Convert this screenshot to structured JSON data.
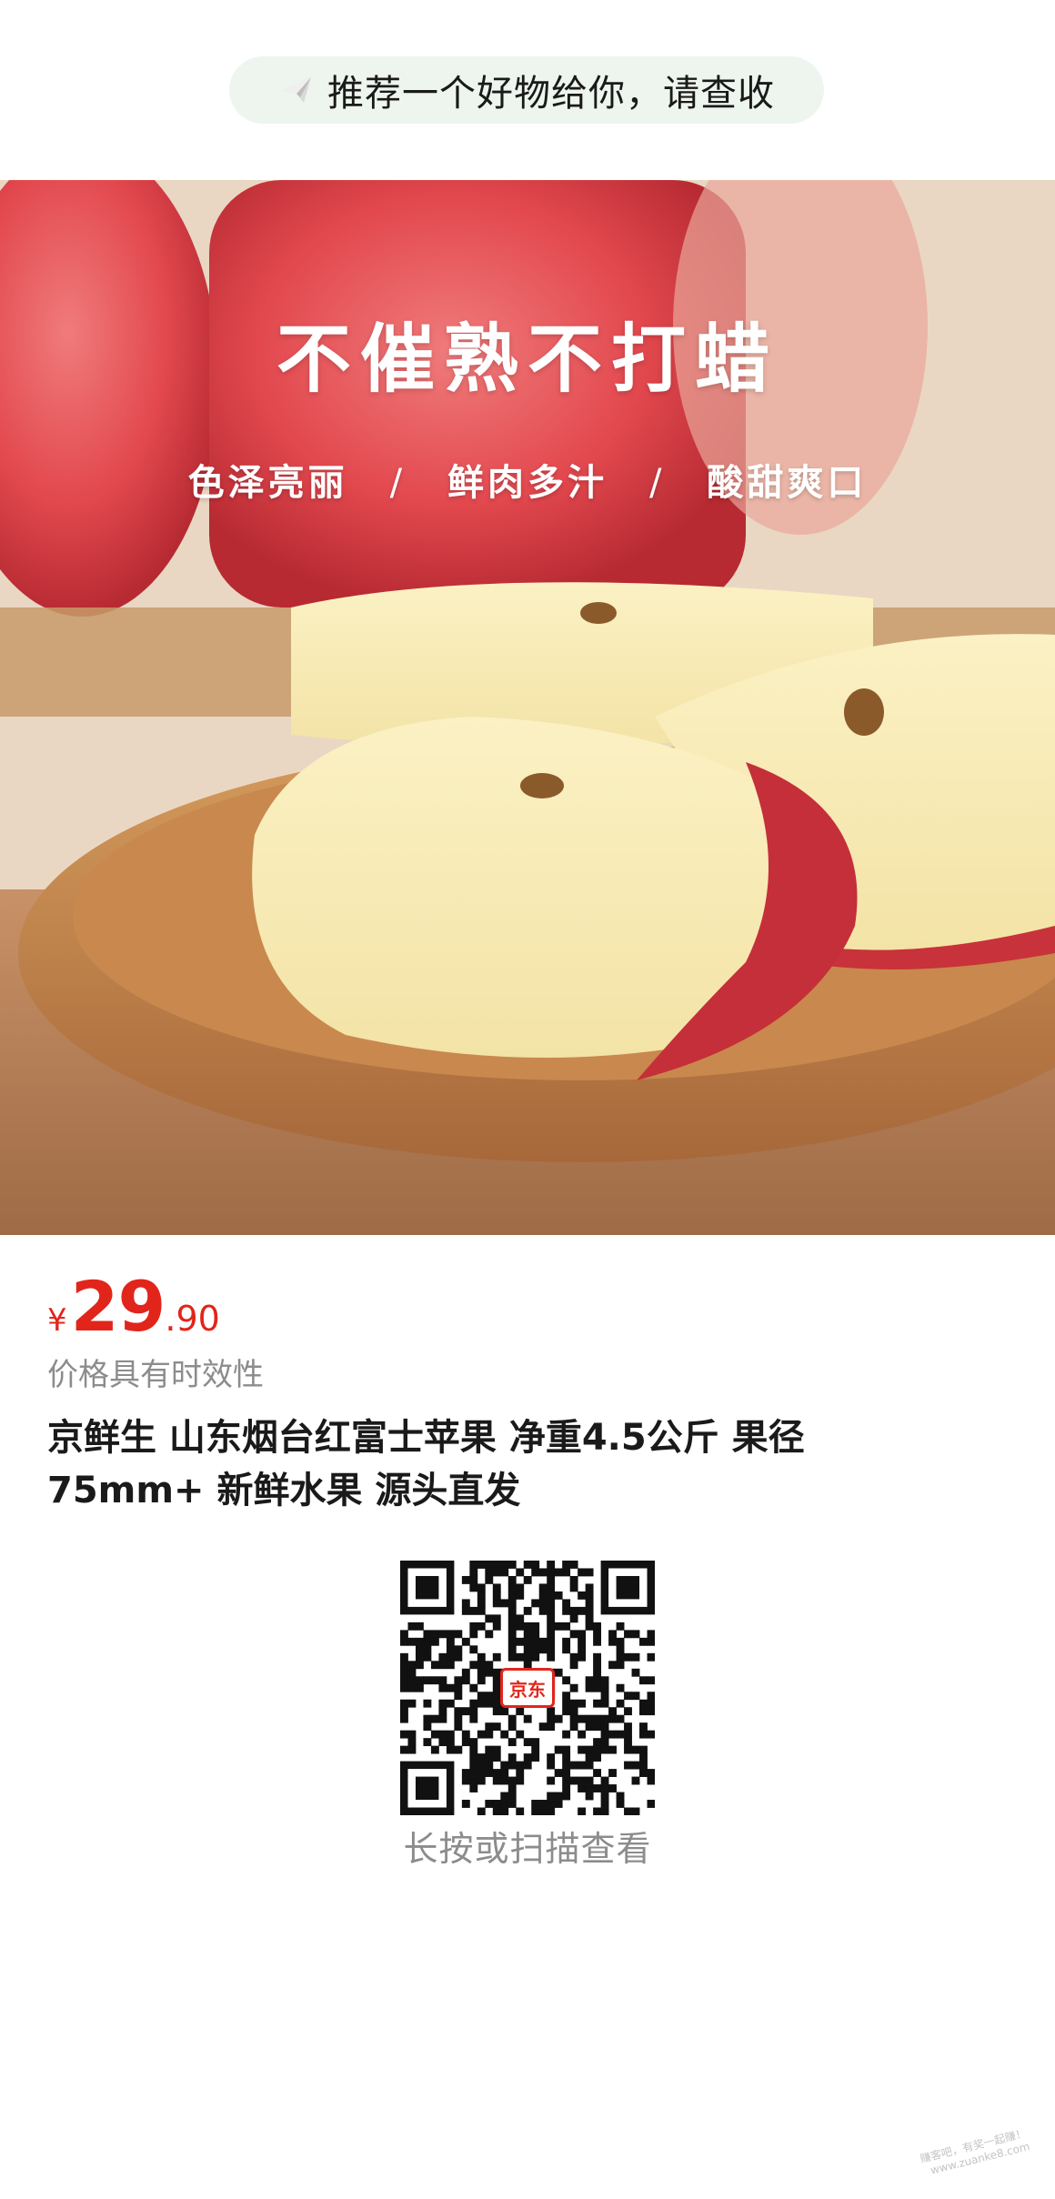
{
  "share_banner": {
    "icon": "paper-plane-icon",
    "text": "推荐一个好物给你，请查收"
  },
  "product_image": {
    "headline": "不催熟不打蜡",
    "tags": [
      "色泽亮丽",
      "鲜肉多汁",
      "酸甜爽口"
    ],
    "tag_separator": "/"
  },
  "price": {
    "symbol": "¥",
    "integer": "29",
    "decimal": ".90",
    "note": "价格具有时效性",
    "color": "#e1251b"
  },
  "product": {
    "title": "京鲜生 山东烟台红富士苹果 净重4.5公斤 果径75mm+ 新鲜水果 源头直发"
  },
  "qr": {
    "logo_text": "京东",
    "hint": "长按或扫描查看"
  },
  "watermark": {
    "text": "赚客吧，有奖一起赚！www.zuanke8.com"
  }
}
